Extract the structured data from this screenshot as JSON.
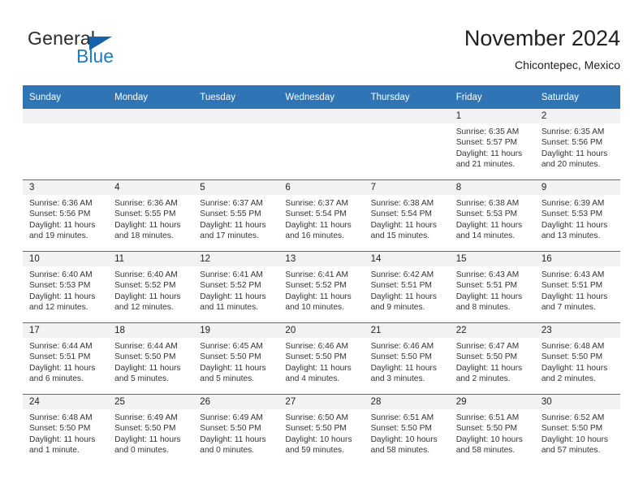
{
  "logo": {
    "word_one": "General",
    "word_two": "Blue",
    "triangle_icon": "triangle-icon",
    "blue": "#1763ab",
    "text_blue": "#1d7bc4"
  },
  "header": {
    "title": "November 2024",
    "subtitle": "Chicontepec, Mexico",
    "accent_color": "#2f74b5",
    "band_color": "#f2f2f2"
  },
  "calendar": {
    "weekday_headers": [
      "Sunday",
      "Monday",
      "Tuesday",
      "Wednesday",
      "Thursday",
      "Friday",
      "Saturday"
    ],
    "weeks": [
      [
        {
          "day": "",
          "lines": []
        },
        {
          "day": "",
          "lines": []
        },
        {
          "day": "",
          "lines": []
        },
        {
          "day": "",
          "lines": []
        },
        {
          "day": "",
          "lines": []
        },
        {
          "day": "1",
          "lines": [
            "Sunrise: 6:35 AM",
            "Sunset: 5:57 PM",
            "Daylight: 11 hours and 21 minutes."
          ]
        },
        {
          "day": "2",
          "lines": [
            "Sunrise: 6:35 AM",
            "Sunset: 5:56 PM",
            "Daylight: 11 hours and 20 minutes."
          ]
        }
      ],
      [
        {
          "day": "3",
          "lines": [
            "Sunrise: 6:36 AM",
            "Sunset: 5:56 PM",
            "Daylight: 11 hours and 19 minutes."
          ]
        },
        {
          "day": "4",
          "lines": [
            "Sunrise: 6:36 AM",
            "Sunset: 5:55 PM",
            "Daylight: 11 hours and 18 minutes."
          ]
        },
        {
          "day": "5",
          "lines": [
            "Sunrise: 6:37 AM",
            "Sunset: 5:55 PM",
            "Daylight: 11 hours and 17 minutes."
          ]
        },
        {
          "day": "6",
          "lines": [
            "Sunrise: 6:37 AM",
            "Sunset: 5:54 PM",
            "Daylight: 11 hours and 16 minutes."
          ]
        },
        {
          "day": "7",
          "lines": [
            "Sunrise: 6:38 AM",
            "Sunset: 5:54 PM",
            "Daylight: 11 hours and 15 minutes."
          ]
        },
        {
          "day": "8",
          "lines": [
            "Sunrise: 6:38 AM",
            "Sunset: 5:53 PM",
            "Daylight: 11 hours and 14 minutes."
          ]
        },
        {
          "day": "9",
          "lines": [
            "Sunrise: 6:39 AM",
            "Sunset: 5:53 PM",
            "Daylight: 11 hours and 13 minutes."
          ]
        }
      ],
      [
        {
          "day": "10",
          "lines": [
            "Sunrise: 6:40 AM",
            "Sunset: 5:53 PM",
            "Daylight: 11 hours and 12 minutes."
          ]
        },
        {
          "day": "11",
          "lines": [
            "Sunrise: 6:40 AM",
            "Sunset: 5:52 PM",
            "Daylight: 11 hours and 12 minutes."
          ]
        },
        {
          "day": "12",
          "lines": [
            "Sunrise: 6:41 AM",
            "Sunset: 5:52 PM",
            "Daylight: 11 hours and 11 minutes."
          ]
        },
        {
          "day": "13",
          "lines": [
            "Sunrise: 6:41 AM",
            "Sunset: 5:52 PM",
            "Daylight: 11 hours and 10 minutes."
          ]
        },
        {
          "day": "14",
          "lines": [
            "Sunrise: 6:42 AM",
            "Sunset: 5:51 PM",
            "Daylight: 11 hours and 9 minutes."
          ]
        },
        {
          "day": "15",
          "lines": [
            "Sunrise: 6:43 AM",
            "Sunset: 5:51 PM",
            "Daylight: 11 hours and 8 minutes."
          ]
        },
        {
          "day": "16",
          "lines": [
            "Sunrise: 6:43 AM",
            "Sunset: 5:51 PM",
            "Daylight: 11 hours and 7 minutes."
          ]
        }
      ],
      [
        {
          "day": "17",
          "lines": [
            "Sunrise: 6:44 AM",
            "Sunset: 5:51 PM",
            "Daylight: 11 hours and 6 minutes."
          ]
        },
        {
          "day": "18",
          "lines": [
            "Sunrise: 6:44 AM",
            "Sunset: 5:50 PM",
            "Daylight: 11 hours and 5 minutes."
          ]
        },
        {
          "day": "19",
          "lines": [
            "Sunrise: 6:45 AM",
            "Sunset: 5:50 PM",
            "Daylight: 11 hours and 5 minutes."
          ]
        },
        {
          "day": "20",
          "lines": [
            "Sunrise: 6:46 AM",
            "Sunset: 5:50 PM",
            "Daylight: 11 hours and 4 minutes."
          ]
        },
        {
          "day": "21",
          "lines": [
            "Sunrise: 6:46 AM",
            "Sunset: 5:50 PM",
            "Daylight: 11 hours and 3 minutes."
          ]
        },
        {
          "day": "22",
          "lines": [
            "Sunrise: 6:47 AM",
            "Sunset: 5:50 PM",
            "Daylight: 11 hours and 2 minutes."
          ]
        },
        {
          "day": "23",
          "lines": [
            "Sunrise: 6:48 AM",
            "Sunset: 5:50 PM",
            "Daylight: 11 hours and 2 minutes."
          ]
        }
      ],
      [
        {
          "day": "24",
          "lines": [
            "Sunrise: 6:48 AM",
            "Sunset: 5:50 PM",
            "Daylight: 11 hours and 1 minute."
          ]
        },
        {
          "day": "25",
          "lines": [
            "Sunrise: 6:49 AM",
            "Sunset: 5:50 PM",
            "Daylight: 11 hours and 0 minutes."
          ]
        },
        {
          "day": "26",
          "lines": [
            "Sunrise: 6:49 AM",
            "Sunset: 5:50 PM",
            "Daylight: 11 hours and 0 minutes."
          ]
        },
        {
          "day": "27",
          "lines": [
            "Sunrise: 6:50 AM",
            "Sunset: 5:50 PM",
            "Daylight: 10 hours and 59 minutes."
          ]
        },
        {
          "day": "28",
          "lines": [
            "Sunrise: 6:51 AM",
            "Sunset: 5:50 PM",
            "Daylight: 10 hours and 58 minutes."
          ]
        },
        {
          "day": "29",
          "lines": [
            "Sunrise: 6:51 AM",
            "Sunset: 5:50 PM",
            "Daylight: 10 hours and 58 minutes."
          ]
        },
        {
          "day": "30",
          "lines": [
            "Sunrise: 6:52 AM",
            "Sunset: 5:50 PM",
            "Daylight: 10 hours and 57 minutes."
          ]
        }
      ]
    ]
  }
}
